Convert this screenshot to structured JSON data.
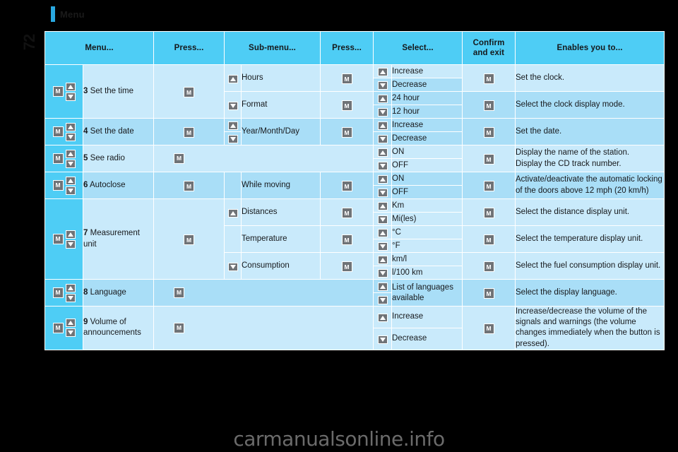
{
  "document": {
    "heading": "Menu",
    "page_number": "72",
    "watermark": "carmanualsonline.info",
    "accent_color": "#29a8e0",
    "header_fill": "#4ecdf5",
    "row_shade_mid": "#a9def7",
    "row_shade_light": "#c9eafb",
    "button_fill": "#6f7377"
  },
  "icons": {
    "m_button": "M",
    "arrow_up": "arrow-up-icon",
    "arrow_down": "arrow-down-icon"
  },
  "table": {
    "columns": [
      "Menu...",
      "Press...",
      "Sub-menu...",
      "Press...",
      "Select...",
      "Confirm and exit",
      "Enables you to..."
    ],
    "column_confirm_line1": "Confirm",
    "column_confirm_line2": "and exit",
    "rows": [
      {
        "index": "3",
        "menu": "Set the time",
        "press": "M",
        "submenus": [
          {
            "label": "Hours",
            "gutter": "arrow-up-icon",
            "press": "M",
            "select": [
              "Increase",
              "Decrease"
            ],
            "confirm": "M",
            "enables": "Set the clock."
          },
          {
            "label": "Format",
            "gutter": "arrow-down-icon",
            "press": "M",
            "select": [
              "24 hour",
              "12 hour"
            ],
            "confirm": "M",
            "enables": "Select the clock display mode."
          }
        ]
      },
      {
        "index": "4",
        "menu": "Set the date",
        "press": "M",
        "submenus": [
          {
            "label": "Year/Month/Day",
            "gutter": "arrow-up-down-icon",
            "press": "M",
            "select": [
              "Increase",
              "Decrease"
            ],
            "confirm": "M",
            "enables": "Set the date."
          }
        ]
      },
      {
        "index": "5",
        "menu": "See radio",
        "press": "M",
        "submenus": [
          {
            "label": "",
            "gutter": "",
            "press": "",
            "select": [
              "ON",
              "OFF"
            ],
            "confirm": "M",
            "enables": "Display the name of the station.\nDisplay the CD track number."
          }
        ]
      },
      {
        "index": "6",
        "menu": "Autoclose",
        "press": "M",
        "submenus": [
          {
            "label": "While moving",
            "gutter": "",
            "press": "M",
            "select": [
              "ON",
              "OFF"
            ],
            "confirm": "M",
            "enables": "Activate/deactivate the automatic locking of the doors above 12 mph (20 km/h)"
          }
        ]
      },
      {
        "index": "7",
        "menu": "Measurement unit",
        "press": "M",
        "submenus": [
          {
            "label": "Distances",
            "gutter": "arrow-up-icon",
            "press": "M",
            "select": [
              "Km",
              "Mi(les)"
            ],
            "confirm": "M",
            "enables": "Select the distance display unit."
          },
          {
            "label": "Temperature",
            "gutter": "",
            "press": "M",
            "select": [
              "°C",
              "°F"
            ],
            "confirm": "M",
            "enables": "Select the temperature display unit."
          },
          {
            "label": "Consumption",
            "gutter": "arrow-down-icon",
            "press": "M",
            "select": [
              "km/l",
              "l/100 km"
            ],
            "confirm": "M",
            "enables": "Select the fuel consumption display unit."
          }
        ]
      },
      {
        "index": "8",
        "menu": "Language",
        "press": "M",
        "submenus": [
          {
            "label": "",
            "gutter": "",
            "press": "",
            "select": [
              "List of languages available"
            ],
            "confirm": "M",
            "enables": "Select the display language."
          }
        ]
      },
      {
        "index": "9",
        "menu": "Volume of announcements",
        "press": "M",
        "submenus": [
          {
            "label": "",
            "gutter": "",
            "press": "",
            "select": [
              "Increase",
              "Decrease"
            ],
            "confirm": "M",
            "enables": "Increase/decrease the volume of the signals and warnings (the volume changes immediately when the button is pressed)."
          }
        ]
      }
    ],
    "cells": {
      "r3_menu_num": "3",
      "r3_menu_text": "Set the time",
      "r4_menu_num": "4",
      "r4_menu_text": "Set the date",
      "r5_menu_num": "5",
      "r5_menu_text": "See radio",
      "r6_menu_num": "6",
      "r6_menu_text": "Autoclose",
      "r7_menu_num": "7",
      "r7_menu_text": "Measurement unit",
      "r8_menu_num": "8",
      "r8_menu_text": "Language",
      "r9_menu_num": "9",
      "r9_menu_text": "Volume of announcements",
      "sub_hours": "Hours",
      "sub_format": "Format",
      "sub_ymd": "Year/Month/Day",
      "sub_while_moving": "While moving",
      "sub_distances": "Distances",
      "sub_temperature": "Temperature",
      "sub_consumption": "Consumption",
      "sel_increase": "Increase",
      "sel_decrease": "Decrease",
      "sel_24h": "24 hour",
      "sel_12h": "12 hour",
      "sel_increase2": "Increase",
      "sel_decrease2": "Decrease",
      "sel_on1": "ON",
      "sel_off1": "OFF",
      "sel_on2": "ON",
      "sel_off2": "OFF",
      "sel_km": "Km",
      "sel_miles": "Mi(les)",
      "sel_c": "°C",
      "sel_f": "°F",
      "sel_kml": "km/l",
      "sel_l100": "l/100 km",
      "sel_langlist": "List of languages available",
      "sel_increase3": "Increase",
      "sel_decrease3": "Decrease",
      "en_clock": "Set the clock.",
      "en_clockmode": "Select the clock display mode.",
      "en_date": "Set the date.",
      "en_radio_1": "Display the name of the station.",
      "en_radio_2": "Display the CD track number.",
      "en_autoclose": "Activate/deactivate the automatic locking of the doors above 12 mph (20 km/h)",
      "en_distance": "Select the distance display unit.",
      "en_temp": "Select the temperature display unit.",
      "en_fuel": "Select the fuel consumption display unit.",
      "en_lang": "Select the display language.",
      "en_volume": "Increase/decrease the volume of the signals and warnings (the volume changes immediately when the button is pressed).",
      "btn_m": "M"
    }
  }
}
